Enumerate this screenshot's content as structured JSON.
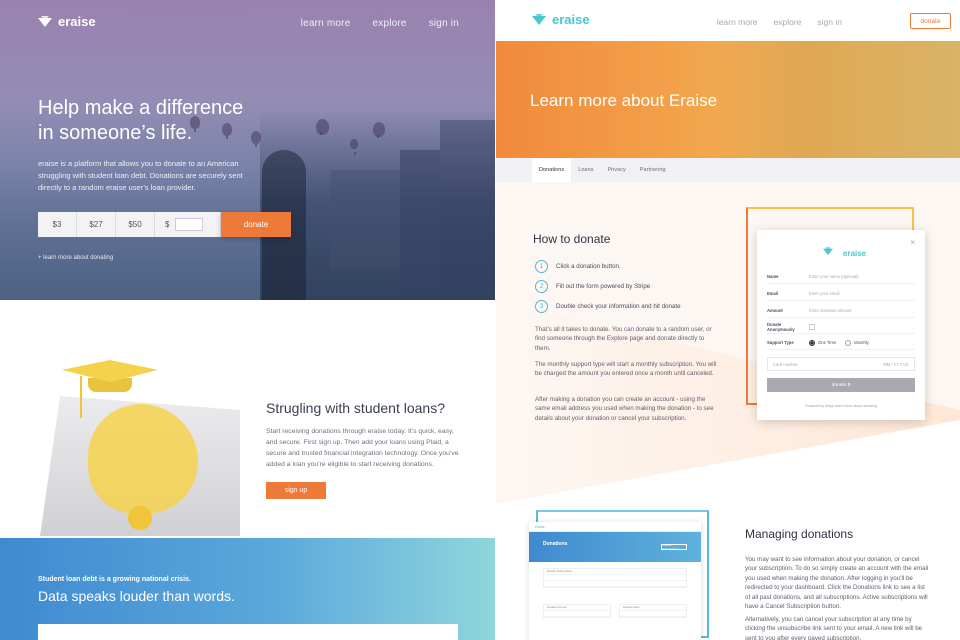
{
  "left": {
    "nav": {
      "logo": "eraise",
      "links": [
        "learn more",
        "explore",
        "sign in"
      ]
    },
    "hero": {
      "title": "Help make a difference in someone’s life.",
      "description": "eraise is a platform that allows you to donate to an American struggling with student loan debt. Donations are securely sent directly to a random eraise user’s loan provider.",
      "amounts": [
        "$3",
        "$27",
        "$50"
      ],
      "custom_prefix": "$",
      "donate_label": "donate",
      "learn_link": "+  learn more about donating"
    },
    "student": {
      "title": "Strugling with student loans?",
      "body": "Start receiving donations through eraise today. It’s quick, easy, and secure. First sign up. Then add your loans using Plaid, a secure and trusted financial integration technology. Once you’ve added a loan you’re eligible to start receiving donations.",
      "signup_label": "sign up"
    },
    "stats": {
      "kicker": "Student loan debt is a growing national crisis.",
      "title": "Data speaks louder than words."
    }
  },
  "right": {
    "nav": {
      "logo": "eraise",
      "links": [
        "learn more",
        "explore",
        "sign in"
      ],
      "donate_label": "donate"
    },
    "banner_title": "Learn more about Eraise",
    "tabs": [
      "Donations",
      "Loans",
      "Privacy",
      "Partnering"
    ],
    "active_tab": "Donations",
    "how": {
      "title": "How to donate",
      "steps": [
        {
          "num": "1",
          "text": "Click a donation button."
        },
        {
          "num": "2",
          "text": "Fill out the form powered by Stripe"
        },
        {
          "num": "3",
          "text": "Double check your information and hit donate"
        }
      ],
      "paragraphs": [
        "That’s all it takes to donate. You can donate to a random user, or find someone through the Explore page and donate directly to them.",
        "The monthly support type will start a monthly subscription. You will be charged the amount you entered once a month until canceled.",
        "After making a donation you can create an account - using the same email address you used when making the donation - to see details about your donation or cancel your subscription."
      ]
    },
    "modal": {
      "logo": "eraise",
      "close": "×",
      "fields": [
        {
          "label": "Name",
          "placeholder": "Enter your name (optional)"
        },
        {
          "label": "Email",
          "placeholder": "Enter your email"
        },
        {
          "label": "Amount",
          "placeholder": "Enter donation amount"
        }
      ],
      "anonymous_label": "Donate Anonymously",
      "support_label": "Support Type",
      "support_options": [
        "One Time",
        "Monthly"
      ],
      "card_placeholder": "Card number",
      "card_expiry": "MM / YY  CVC",
      "donate_label": "donate $",
      "powered": "Powered by stripe    learn more about donating"
    },
    "dashboard": {
      "brand": "eraise",
      "title": "Donations",
      "button": "Cancel Subscription",
      "rows": [
        "Monthly Subscriptions",
        "",
        "",
        "Donation Amount",
        "",
        "Donation Date"
      ]
    },
    "manage": {
      "title": "Managing donations",
      "paragraphs": [
        "You may want to see information about your donation, or cancel your subscription. To do so simply create an account with the email you used when making the donation. After logging in you’ll be redirected to your dashboard. Click the Donations link to see a list of all past donations, and all subscriptions. Active subscriptions will have a Cancel Subscription button.",
        "Alternatively, you can cancel your subscription at any time by clicking the unsubscribe link sent to your email. A new link will be sent to you after every payed subscription."
      ]
    }
  },
  "colors": {
    "accent_orange": "#ee7a3a",
    "brand_teal": "#47c7cf",
    "stats_blue": "#3f8ad0",
    "cap_yellow": "#f4d24c"
  }
}
